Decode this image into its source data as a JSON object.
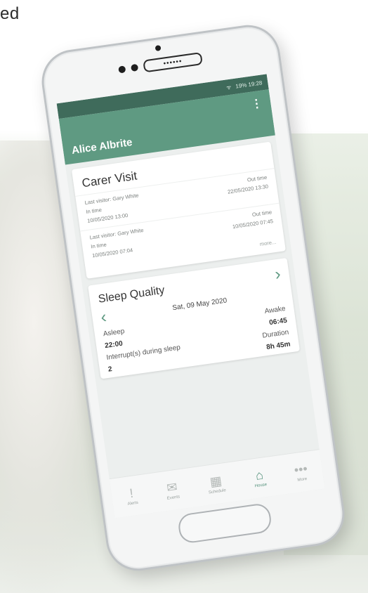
{
  "headline_fragment": "ed",
  "status_bar": {
    "text": "19% 19:28"
  },
  "app_bar": {
    "title": "Alice Albrite",
    "menu_glyph": "⋮"
  },
  "carer_visit": {
    "title": "Carer Visit",
    "visits": [
      {
        "visitor": "Last visitor: Gary White",
        "in_label": "In time",
        "in_time": "10/05/2020 13:00",
        "out_label": "Out time",
        "out_time": "22/05/2020 13:30"
      },
      {
        "visitor": "Last visitor: Gary White",
        "in_label": "In time",
        "in_time": "10/05/2020 07:04",
        "out_label": "Out time",
        "out_time": "10/05/2020 07:45"
      }
    ],
    "more": "more..."
  },
  "sleep_quality": {
    "title": "Sleep Quality",
    "date": "Sat, 09 May 2020",
    "asleep_label": "Asleep",
    "asleep_value": "22:00",
    "awake_label": "Awake",
    "awake_value": "06:45",
    "interrupt_label": "Interrupt(s) during sleep",
    "interrupt_value": "2",
    "duration_label": "Duration",
    "duration_value": "8h 45m"
  },
  "tabs": [
    {
      "label": "Alerts",
      "icon": "alert-icon"
    },
    {
      "label": "Events",
      "icon": "mail-icon"
    },
    {
      "label": "Schedule",
      "icon": "calendar-icon"
    },
    {
      "label": "House",
      "icon": "home-icon"
    },
    {
      "label": "More",
      "icon": "more-icon"
    }
  ],
  "colors": {
    "primary": "#5f9a82",
    "status": "#3f6b5b",
    "active": "#4f8f78"
  }
}
